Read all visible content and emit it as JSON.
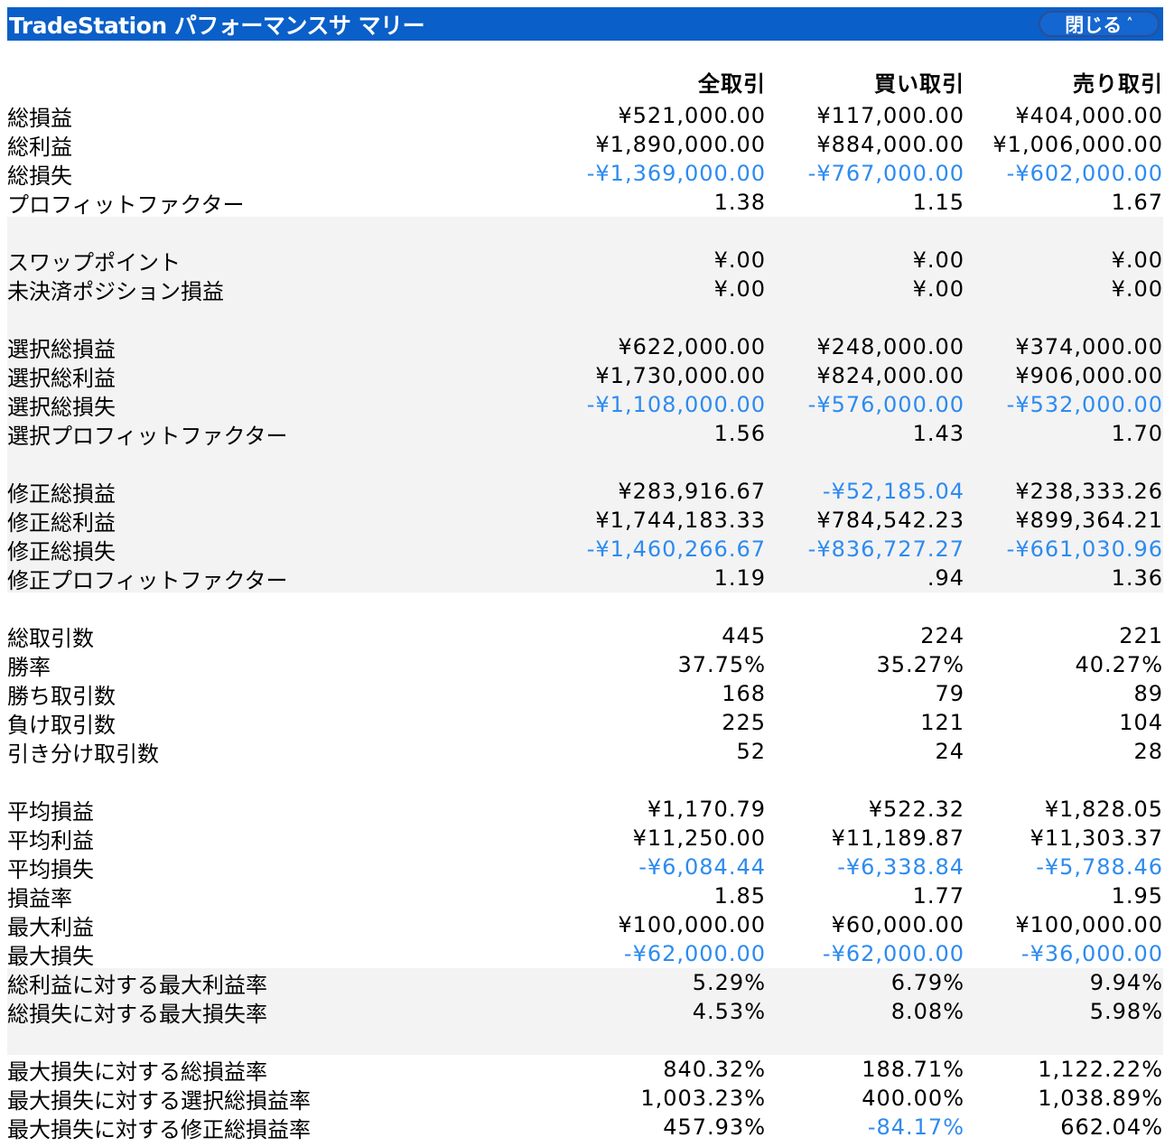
{
  "title": "TradeStation パフォーマンスサ マリー",
  "close_label": "閉じる",
  "columns": [
    "全取引",
    "買い取引",
    "売り取引"
  ],
  "colors": {
    "titlebar": "#0a5fc8",
    "negative_text": "#2d8bf0",
    "shade": "#f3f3f3"
  },
  "rows": [
    {
      "label": "総損益",
      "values": [
        "¥521,000.00",
        "¥117,000.00",
        "¥404,000.00"
      ],
      "neg": [
        false,
        false,
        false
      ]
    },
    {
      "label": "総利益",
      "values": [
        "¥1,890,000.00",
        "¥884,000.00",
        "¥1,006,000.00"
      ],
      "neg": [
        false,
        false,
        false
      ]
    },
    {
      "label": "総損失",
      "values": [
        "-¥1,369,000.00",
        "-¥767,000.00",
        "-¥602,000.00"
      ],
      "neg": [
        true,
        true,
        true
      ]
    },
    {
      "label": "プロフィットファクター",
      "values": [
        "1.38",
        "1.15",
        "1.67"
      ],
      "neg": [
        false,
        false,
        false
      ]
    },
    {
      "label": "",
      "values": [
        "",
        "",
        ""
      ],
      "neg": [
        false,
        false,
        false
      ]
    },
    {
      "label": "スワップポイント",
      "values": [
        "¥.00",
        "¥.00",
        "¥.00"
      ],
      "neg": [
        false,
        false,
        false
      ]
    },
    {
      "label": "未決済ポジション損益",
      "values": [
        "¥.00",
        "¥.00",
        "¥.00"
      ],
      "neg": [
        false,
        false,
        false
      ]
    },
    {
      "label": "",
      "values": [
        "",
        "",
        ""
      ],
      "neg": [
        false,
        false,
        false
      ]
    },
    {
      "label": "選択総損益",
      "values": [
        "¥622,000.00",
        "¥248,000.00",
        "¥374,000.00"
      ],
      "neg": [
        false,
        false,
        false
      ]
    },
    {
      "label": "選択総利益",
      "values": [
        "¥1,730,000.00",
        "¥824,000.00",
        "¥906,000.00"
      ],
      "neg": [
        false,
        false,
        false
      ]
    },
    {
      "label": "選択総損失",
      "values": [
        "-¥1,108,000.00",
        "-¥576,000.00",
        "-¥532,000.00"
      ],
      "neg": [
        true,
        true,
        true
      ]
    },
    {
      "label": "選択プロフィットファクター",
      "values": [
        "1.56",
        "1.43",
        "1.70"
      ],
      "neg": [
        false,
        false,
        false
      ]
    },
    {
      "label": "",
      "values": [
        "",
        "",
        ""
      ],
      "neg": [
        false,
        false,
        false
      ]
    },
    {
      "label": "修正総損益",
      "values": [
        "¥283,916.67",
        "-¥52,185.04",
        "¥238,333.26"
      ],
      "neg": [
        false,
        true,
        false
      ]
    },
    {
      "label": "修正総利益",
      "values": [
        "¥1,744,183.33",
        "¥784,542.23",
        "¥899,364.21"
      ],
      "neg": [
        false,
        false,
        false
      ]
    },
    {
      "label": "修正総損失",
      "values": [
        "-¥1,460,266.67",
        "-¥836,727.27",
        "-¥661,030.96"
      ],
      "neg": [
        true,
        true,
        true
      ]
    },
    {
      "label": "修正プロフィットファクター",
      "values": [
        "1.19",
        ".94",
        "1.36"
      ],
      "neg": [
        false,
        false,
        false
      ]
    },
    {
      "label": "",
      "values": [
        "",
        "",
        ""
      ],
      "neg": [
        false,
        false,
        false
      ]
    },
    {
      "label": "総取引数",
      "values": [
        "445",
        "224",
        "221"
      ],
      "neg": [
        false,
        false,
        false
      ]
    },
    {
      "label": "勝率",
      "values": [
        "37.75%",
        "35.27%",
        "40.27%"
      ],
      "neg": [
        false,
        false,
        false
      ]
    },
    {
      "label": "勝ち取引数",
      "values": [
        "168",
        "79",
        "89"
      ],
      "neg": [
        false,
        false,
        false
      ]
    },
    {
      "label": "負け取引数",
      "values": [
        "225",
        "121",
        "104"
      ],
      "neg": [
        false,
        false,
        false
      ]
    },
    {
      "label": "引き分け取引数",
      "values": [
        "52",
        "24",
        "28"
      ],
      "neg": [
        false,
        false,
        false
      ]
    },
    {
      "label": "",
      "values": [
        "",
        "",
        ""
      ],
      "neg": [
        false,
        false,
        false
      ]
    },
    {
      "label": "平均損益",
      "values": [
        "¥1,170.79",
        "¥522.32",
        "¥1,828.05"
      ],
      "neg": [
        false,
        false,
        false
      ]
    },
    {
      "label": "平均利益",
      "values": [
        "¥11,250.00",
        "¥11,189.87",
        "¥11,303.37"
      ],
      "neg": [
        false,
        false,
        false
      ]
    },
    {
      "label": "平均損失",
      "values": [
        "-¥6,084.44",
        "-¥6,338.84",
        "-¥5,788.46"
      ],
      "neg": [
        true,
        true,
        true
      ]
    },
    {
      "label": "損益率",
      "values": [
        "1.85",
        "1.77",
        "1.95"
      ],
      "neg": [
        false,
        false,
        false
      ]
    },
    {
      "label": "最大利益",
      "values": [
        "¥100,000.00",
        "¥60,000.00",
        "¥100,000.00"
      ],
      "neg": [
        false,
        false,
        false
      ]
    },
    {
      "label": "最大損失",
      "values": [
        "-¥62,000.00",
        "-¥62,000.00",
        "-¥36,000.00"
      ],
      "neg": [
        true,
        true,
        true
      ]
    },
    {
      "label": "総利益に対する最大利益率",
      "values": [
        "5.29%",
        "6.79%",
        "9.94%"
      ],
      "neg": [
        false,
        false,
        false
      ]
    },
    {
      "label": "総損失に対する最大損失率",
      "values": [
        "4.53%",
        "8.08%",
        "5.98%"
      ],
      "neg": [
        false,
        false,
        false
      ]
    },
    {
      "label": "",
      "values": [
        "",
        "",
        ""
      ],
      "neg": [
        false,
        false,
        false
      ]
    },
    {
      "label": "最大損失に対する総損益率",
      "values": [
        "840.32%",
        "188.71%",
        "1,122.22%"
      ],
      "neg": [
        false,
        false,
        false
      ]
    },
    {
      "label": "最大損失に対する選択総損益率",
      "values": [
        "1,003.23%",
        "400.00%",
        "1,038.89%"
      ],
      "neg": [
        false,
        false,
        false
      ]
    },
    {
      "label": "最大損失に対する修正総損益率",
      "values": [
        "457.93%",
        "-84.17%",
        "662.04%"
      ],
      "neg": [
        false,
        true,
        false
      ]
    }
  ]
}
